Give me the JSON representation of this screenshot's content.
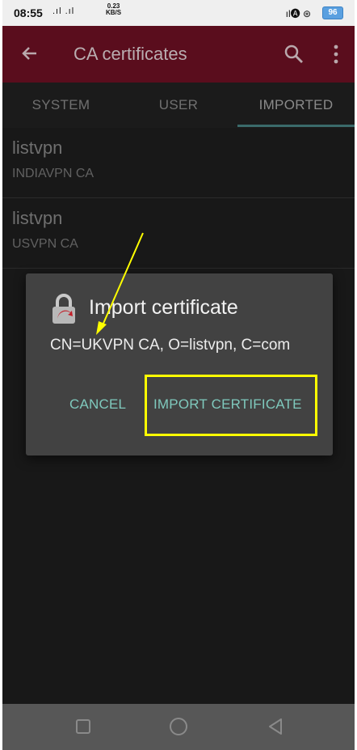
{
  "status_bar": {
    "time": "08:55",
    "signal": ".ıl .ıl",
    "speed_value": "0.23",
    "speed_unit": "KB/S",
    "right_icons": "ıl🅐 ⊛",
    "battery": "96"
  },
  "app_bar": {
    "title": "CA certificates"
  },
  "tabs": [
    {
      "label": "SYSTEM"
    },
    {
      "label": "USER"
    },
    {
      "label": "IMPORTED"
    }
  ],
  "certificates": [
    {
      "name": "listvpn",
      "ca": "INDIAVPN CA"
    },
    {
      "name": "listvpn",
      "ca": "USVPN CA"
    }
  ],
  "dialog": {
    "title": "Import certificate",
    "message": "CN=UKVPN CA, O=listvpn, C=com",
    "cancel_label": "CANCEL",
    "import_label": "IMPORT CERTIFICATE"
  },
  "colors": {
    "app_bar": "#5a0d1d",
    "accent": "#7fc9bd",
    "annotation": "#ffff00"
  }
}
